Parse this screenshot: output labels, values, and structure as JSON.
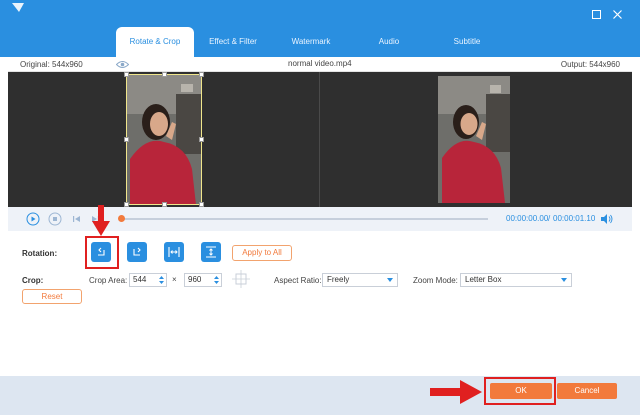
{
  "tabs": [
    {
      "label": "Rotate & Crop",
      "active": true
    },
    {
      "label": "Effect & Filter",
      "active": false
    },
    {
      "label": "Watermark",
      "active": false
    },
    {
      "label": "Audio",
      "active": false
    },
    {
      "label": "Subtitle",
      "active": false
    }
  ],
  "window": {
    "maximize_icon": "maximize-icon",
    "close_icon": "close-icon"
  },
  "info": {
    "original": "Original: 544x960",
    "filename": "normal video.mp4",
    "output": "Output: 544x960"
  },
  "player": {
    "current_time": "00:00:00.00",
    "separator": "/",
    "total_time": "00:00:01.10",
    "progress": 0.0
  },
  "rotation": {
    "label": "Rotation:",
    "buttons": [
      "rotate-left-icon",
      "rotate-right-icon",
      "flip-horizontal-icon",
      "flip-vertical-icon"
    ],
    "apply_label": "Apply to All"
  },
  "crop": {
    "label": "Crop:",
    "area_label": "Crop Area:",
    "width": "544",
    "times": "×",
    "height": "960",
    "aspect_label": "Aspect Ratio:",
    "aspect_value": "Freely",
    "zoom_label": "Zoom Mode:",
    "zoom_value": "Letter Box",
    "reset_label": "Reset"
  },
  "footer": {
    "ok_label": "OK",
    "cancel_label": "Cancel"
  },
  "colors": {
    "accent": "#2a8fe0",
    "orange": "#f27a3c",
    "highlight_red": "#e02020"
  }
}
